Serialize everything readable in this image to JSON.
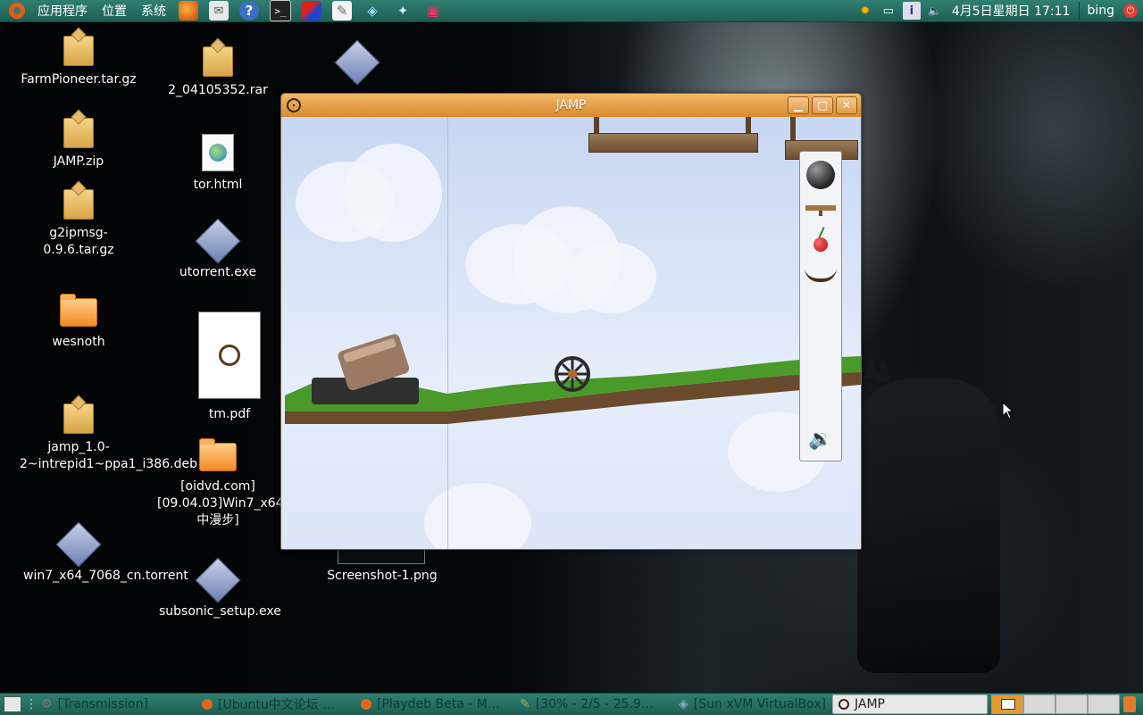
{
  "top_panel": {
    "menus": [
      "应用程序",
      "位置",
      "系统"
    ],
    "datetime": "4月5日星期日 17:11",
    "user": "bing"
  },
  "desktop": {
    "icons": [
      {
        "label": "FarmPioneer.tar.gz",
        "type": "package-icon"
      },
      {
        "label": "JAMP.zip",
        "type": "package-icon"
      },
      {
        "label": "g2ipmsg-0.9.6.tar.gz",
        "type": "package-icon"
      },
      {
        "label": "wesnoth",
        "type": "folder-icon"
      },
      {
        "label": "jamp_1.0-2~intrepid1~ppa1_i386.deb",
        "type": "package-icon"
      },
      {
        "label": "win7_x64_7068_cn.torrent",
        "type": "torrent-icon"
      },
      {
        "label": "2_04105352.rar",
        "type": "package-icon"
      },
      {
        "label": "tor.html",
        "type": "html-icon"
      },
      {
        "label": "utorrent.exe",
        "type": "exe-icon"
      },
      {
        "label": "tm.pdf",
        "type": "pdf-thumbnail"
      },
      {
        "label": "[oidvd.com][09.04.03]Win7_x64_7068_cn[网中漫步]",
        "type": "folder-icon"
      },
      {
        "label": "subsonic_setup.exe",
        "type": "exe-icon"
      },
      {
        "label": "Screenshot-1.png",
        "type": "image-thumbnail"
      }
    ]
  },
  "window": {
    "title": "JAMP",
    "palette_items": [
      "bowling-ball",
      "plank",
      "cherry",
      "hammock",
      "speaker"
    ]
  },
  "taskbar": {
    "items": [
      {
        "label": "[Transmission]",
        "active": false
      },
      {
        "label": "[Ubuntu中文论坛 …",
        "active": false
      },
      {
        "label": "[Playdeb Beta - M…",
        "active": false
      },
      {
        "label": "[30% - 2/5 - 25.9…",
        "active": false
      },
      {
        "label": "[Sun xVM VirtualBox]",
        "active": false
      },
      {
        "label": "JAMP",
        "active": true
      }
    ]
  },
  "colors": {
    "panel": "#2f7f71",
    "titlebar": "#e5a04c",
    "taskbar_active": "#e8e8e8"
  }
}
